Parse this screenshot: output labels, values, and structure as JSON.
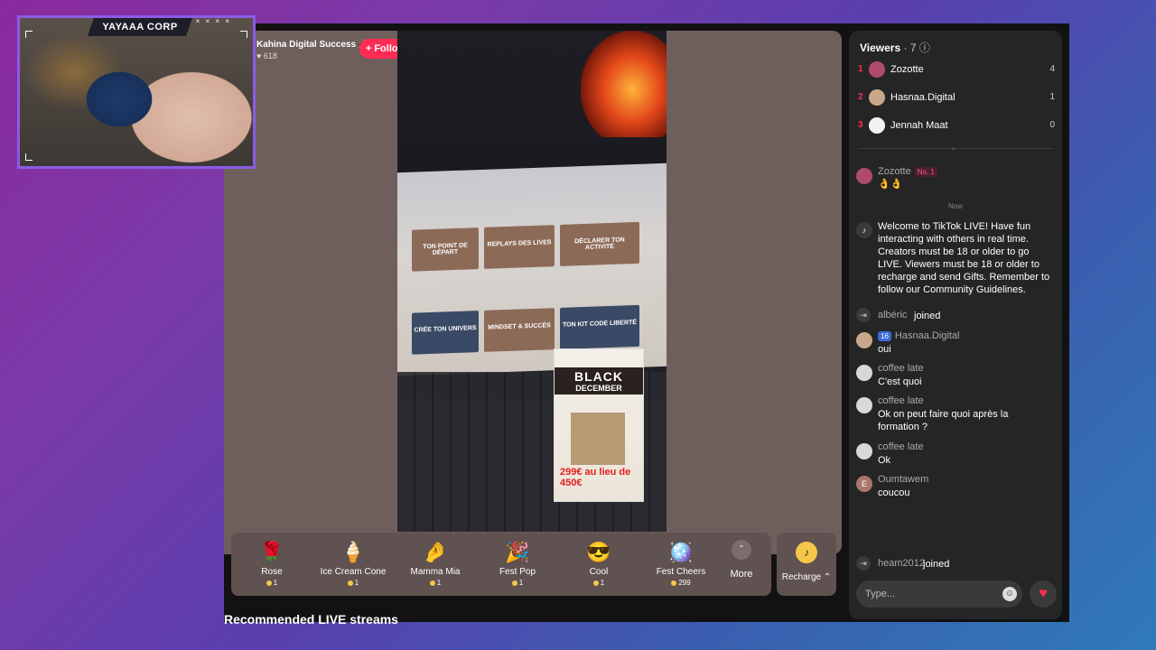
{
  "webcam": {
    "label": "YAYAAA CORP",
    "dots": "× × × ×"
  },
  "host": {
    "name": "Kahina Digital Success 🚀",
    "likes": "♥ 618",
    "follow_label": "+ Follow"
  },
  "video": {
    "tiles": [
      "TON POINT DE DÉPART",
      "REPLAYS DES LIVES",
      "DÉCLARER TON ACTIVITÉ",
      "CRÉE TON UNIVERS",
      "MINDSET & SUCCÈS",
      "TON KIT CODE LIBERTÉ"
    ],
    "poster": {
      "title": "BLACK",
      "subtitle": "DECEMBER",
      "price": "299€ au lieu de 450€"
    }
  },
  "gifts": [
    {
      "icon": "🌹",
      "name": "Rose",
      "price": "1"
    },
    {
      "icon": "🍦",
      "name": "Ice Cream Cone",
      "price": "1"
    },
    {
      "icon": "🤌",
      "name": "Mamma Mia",
      "price": "1"
    },
    {
      "icon": "🎉",
      "name": "Fest Pop",
      "price": "1"
    },
    {
      "icon": "😎",
      "name": "Cool",
      "price": "1"
    },
    {
      "icon": "🪩",
      "name": "Fest Cheers",
      "price": "299"
    }
  ],
  "more_label": "More",
  "recharge_label": "Recharge ⌃",
  "recommended_title": "Recommended LIVE streams",
  "viewers": {
    "title": "Viewers",
    "count": "· 7 ⓘ",
    "list": [
      {
        "rank": "1",
        "name": "Zozotte",
        "score": "4",
        "color": "#b04a6a"
      },
      {
        "rank": "2",
        "name": "Hasnaa.Digital",
        "score": "1",
        "color": "#c9a78a"
      },
      {
        "rank": "3",
        "name": "Jennah Maat",
        "score": "0",
        "color": "#f2f2f2"
      }
    ]
  },
  "chat": {
    "top_msg": {
      "name": "Zozotte",
      "badge": "No. 1",
      "text": "👌👌"
    },
    "now_label": "Now",
    "welcome": "Welcome to TikTok LIVE! Have fun interacting with others in real time. Creators must be 18 or older to go LIVE. Viewers must be 18 or older to recharge and send Gifts. Remember to follow our Community Guidelines.",
    "join1": {
      "name": "albéric",
      "action": "joined"
    },
    "m1": {
      "level": "16",
      "name": "Hasnaa.Digital",
      "text": "oui"
    },
    "m2": {
      "name": "coffee late",
      "text": "C'est quoi"
    },
    "m3": {
      "name": "coffee late",
      "text": "Ok on peut faire quoi après la formation ?"
    },
    "m4": {
      "name": "coffee late",
      "text": "Ok"
    },
    "m5": {
      "name": "Oumtawem",
      "initial": "E",
      "text": "coucou"
    },
    "join2": {
      "name": "heam2012",
      "action": "joined"
    },
    "input_placeholder": "Type..."
  }
}
